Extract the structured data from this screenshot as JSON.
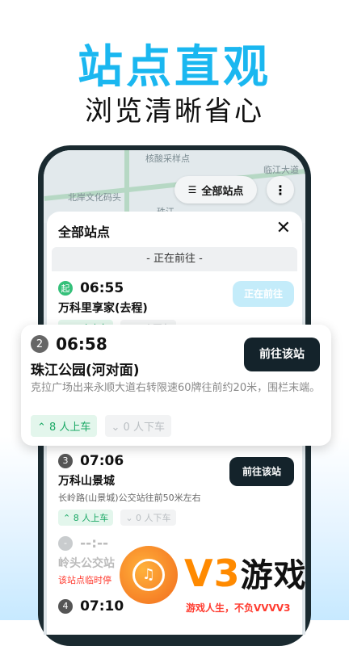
{
  "headline": "站点直观",
  "subline": "浏览清晰省心",
  "map": {
    "label_top": "核酸采样点",
    "label_right": "临江大道",
    "label_left": "北岸文化码头",
    "label_mid": "珠江",
    "all_stops_button": "全部站点",
    "all_stops_icon": "list-icon",
    "more_icon": "more-vertical-icon"
  },
  "sheet": {
    "title": "全部站点",
    "close_label": "✕",
    "going_bar": "- 正在前往 -"
  },
  "stops": [
    {
      "badge": "起",
      "time": "06:55",
      "name": "万科里享家(去程)",
      "boarding": "8 人上车",
      "alighting": "0 人下车",
      "action": "正在前往"
    },
    {
      "badge": "2",
      "time": "06:58",
      "name": "珠江公园(河对面)",
      "desc": "克拉广场出来永顺大道右转限速60牌往前约20米，围栏末端。",
      "boarding": "8 人上车",
      "alighting": "0 人下车",
      "action": "前往该站"
    },
    {
      "badge": "3",
      "time": "07:06",
      "name": "万科山景城",
      "desc": "长岭路(山景城)公交站往前50米左右",
      "boarding": "8 人上车",
      "alighting": "0 人下车",
      "action": "前往该站"
    },
    {
      "badge": "-",
      "time": "--:--",
      "name": "岭头公交站",
      "desc": "该站点临时停"
    },
    {
      "badge": "4",
      "time": "07:10"
    }
  ],
  "watermark": {
    "brand": "V3",
    "brand_cn": "游戏",
    "slogan": "游戏人生，不负VVVV3"
  },
  "colors": {
    "accent": "#1ab7f0",
    "dark_button": "#14232b",
    "boarding_green": "#1aa865",
    "brand_orange": "#ff8a00"
  }
}
